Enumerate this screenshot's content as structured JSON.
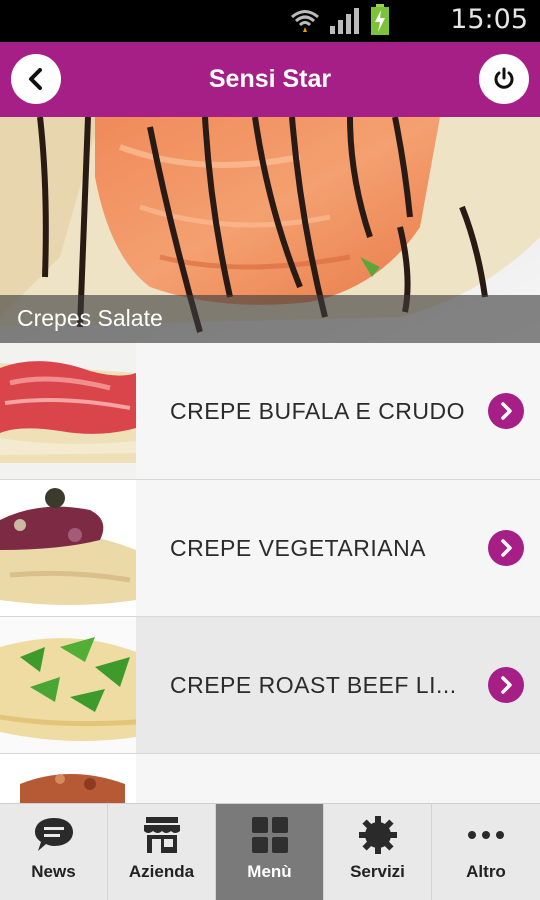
{
  "status_bar": {
    "time": "15:05"
  },
  "header": {
    "title": "Sensi Star"
  },
  "hero": {
    "caption": "Crepes Salate"
  },
  "menu_items": [
    {
      "label": "CREPE BUFALA E CRUDO"
    },
    {
      "label": "CREPE VEGETARIANA"
    },
    {
      "label": "CREPE ROAST BEEF LI..."
    },
    {
      "label": ""
    }
  ],
  "tabs": [
    {
      "label": "News",
      "icon": "chat-bubble-icon"
    },
    {
      "label": "Azienda",
      "icon": "store-icon"
    },
    {
      "label": "Menù",
      "icon": "grid-icon",
      "active": true
    },
    {
      "label": "Servizi",
      "icon": "gear-icon"
    },
    {
      "label": "Altro",
      "icon": "more-dots-icon"
    }
  ],
  "colors": {
    "accent": "#a51f86",
    "active_tab": "#7a7a7a"
  }
}
